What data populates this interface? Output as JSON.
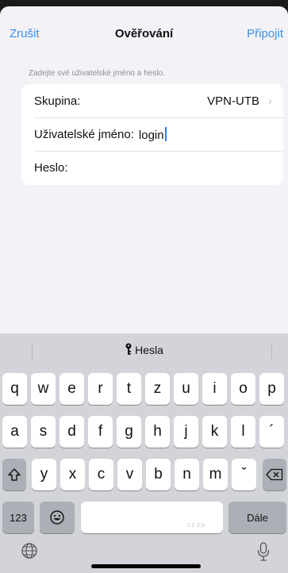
{
  "nav": {
    "cancel": "Zrušit",
    "title": "Ověřování",
    "connect": "Připojit"
  },
  "form": {
    "hint": "Zadejte své uživatelské jméno a heslo.",
    "group_label": "Skupina:",
    "group_value": "VPN-UTB",
    "username_label": "Uživatelské jméno:",
    "username_value": "login",
    "password_label": "Heslo:"
  },
  "keyboard": {
    "suggestion": "Hesla",
    "row1": [
      "q",
      "w",
      "e",
      "r",
      "t",
      "z",
      "u",
      "i",
      "o",
      "p"
    ],
    "row2": [
      "a",
      "s",
      "d",
      "f",
      "g",
      "h",
      "j",
      "k",
      "l",
      "´"
    ],
    "row3": [
      "y",
      "x",
      "c",
      "v",
      "b",
      "n",
      "m",
      "ˇ"
    ],
    "numbers_key": "123",
    "space_brand": "CZ EN",
    "return_key": "Dále"
  },
  "icons": {
    "chevron": "chevron-right-icon",
    "key": "key-icon",
    "shift": "shift-icon",
    "delete": "delete-icon",
    "emoji": "emoji-icon",
    "globe": "globe-icon",
    "mic": "microphone-icon"
  }
}
